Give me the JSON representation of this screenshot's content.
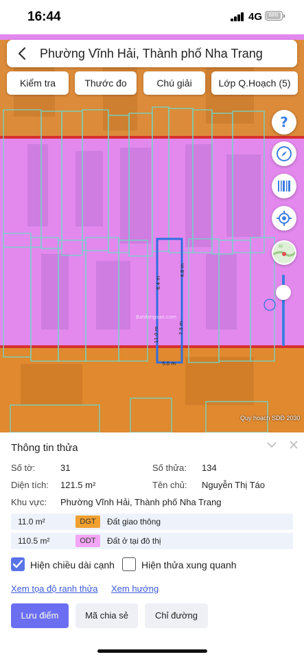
{
  "status": {
    "time": "16:44",
    "network": "4G",
    "battery_label": "BBB"
  },
  "map": {
    "location_title": "Phường Vĩnh Hải, Thành phố Nha Trang",
    "tools": [
      "Kiểm tra",
      "Thước đo",
      "Chú giải",
      "Lớp Q.Hoạch (5)"
    ],
    "fab_icons": [
      "help-icon",
      "compass-icon",
      "barcode-icon",
      "locate-icon",
      "map-thumbnail-icon"
    ],
    "dimensions": [
      "6.4 m",
      "4.8 m",
      "7.3 m",
      "11.0 m",
      "5.0 m"
    ],
    "watermark": "Batdongsan.com",
    "caption": "Quy hoạch SDĐ 2030",
    "colors": {
      "residential": "#e58af2",
      "transport": "#e08a2e",
      "border": "#d63030",
      "parcel": "#2f6fe0",
      "outline": "#6fd6c8"
    }
  },
  "panel": {
    "title": "Thông tin thửa",
    "to_label": "Số tờ:",
    "to_value": "31",
    "thua_label": "Số thửa:",
    "thua_value": "134",
    "area_label": "Diện tích:",
    "area_value": "121.5 m²",
    "owner_label": "Tên chủ:",
    "owner_value": "Nguyễn Thị Táo",
    "region_label": "Khu vực:",
    "region_value": "Phường Vĩnh Hải, Thành phố Nha Trang",
    "land_uses": [
      {
        "area": "11.0 m²",
        "code": "DGT",
        "name": "Đất giao thông",
        "color": "#f0a030"
      },
      {
        "area": "110.5 m²",
        "code": "ODT",
        "name": "Đất ở tại đô thị",
        "color": "#f2a6f5"
      }
    ],
    "show_edge_label": "Hiện chiều dài cạnh",
    "show_neighbors_label": "Hiện thửa xung quanh",
    "coords_link": "Xem tọa độ ranh thửa",
    "direction_link": "Xem hướng",
    "save_button": "Lưu điểm",
    "share_button": "Mã chia sẻ",
    "route_button": "Chỉ đường"
  }
}
